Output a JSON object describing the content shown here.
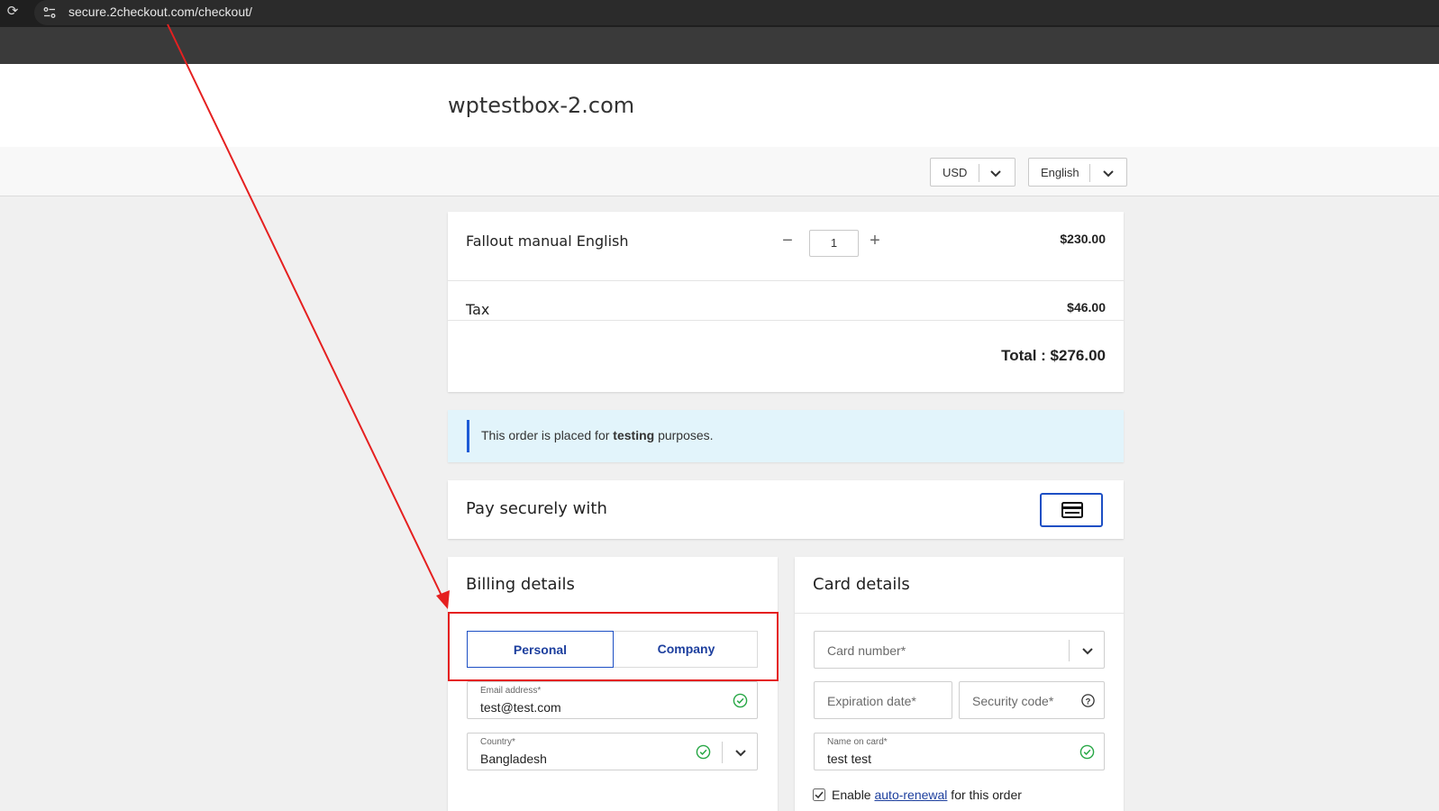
{
  "browser": {
    "url": "secure.2checkout.com/checkout/"
  },
  "header": {
    "site_title": "wptestbox-2.com",
    "currency": "USD",
    "language": "English"
  },
  "order": {
    "product_name": "Fallout manual English",
    "quantity": "1",
    "minus_label": "−",
    "plus_label": "+",
    "price": "$230.00",
    "tax_label": "Tax",
    "tax_value": "$46.00",
    "total": "Total : $276.00"
  },
  "notice": {
    "text_before": "This order is placed for ",
    "text_bold": "testing",
    "text_after": " purposes."
  },
  "payment": {
    "title": "Pay securely with",
    "method_icon": "credit-card-icon"
  },
  "billing": {
    "title": "Billing details",
    "tabs": [
      "Personal",
      "Company"
    ],
    "active_tab": "Personal",
    "email_label": "Email address*",
    "email_value": "test@test.com",
    "country_label": "Country*",
    "country_value": "Bangladesh"
  },
  "card": {
    "title": "Card details",
    "card_number_placeholder": "Card number*",
    "expiration_placeholder": "Expiration date*",
    "security_placeholder": "Security code*",
    "name_label": "Name on card*",
    "name_value": "test test",
    "renew_before": "Enable ",
    "renew_link": "auto-renewal",
    "renew_after": " for this order",
    "renew_checked": true
  },
  "colors": {
    "accent": "#1d4fc4",
    "annotation": "#e52020",
    "success": "#27a745",
    "notice_bg": "#e2f4fb"
  }
}
